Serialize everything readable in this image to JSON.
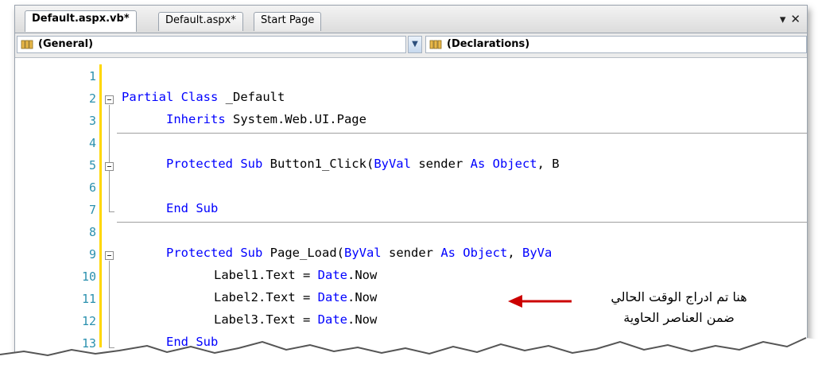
{
  "tabs": [
    {
      "label": "Default.aspx.vb*",
      "active": true
    },
    {
      "label": "Default.aspx*",
      "active": false
    },
    {
      "label": "Start Page",
      "active": false
    }
  ],
  "tab_controls": {
    "dropdown_glyph": "▾",
    "close_glyph": "✕"
  },
  "dropdowns": {
    "object_selector": "(General)",
    "member_selector": "(Declarations)"
  },
  "line_numbers": [
    "1",
    "2",
    "3",
    "4",
    "5",
    "6",
    "7",
    "8",
    "9",
    "10",
    "11",
    "12",
    "13"
  ],
  "code": {
    "line2": [
      {
        "t": "Partial Class",
        "kw": true
      },
      {
        "t": " _Default",
        "kw": false
      }
    ],
    "line3": [
      {
        "t": "Inherits",
        "kw": true
      },
      {
        "t": " System.Web.UI.Page",
        "kw": false
      }
    ],
    "line5": [
      {
        "t": "Protected Sub",
        "kw": true
      },
      {
        "t": " Button1_Click(",
        "kw": false
      },
      {
        "t": "ByVal",
        "kw": true
      },
      {
        "t": " sender ",
        "kw": false
      },
      {
        "t": "As Object",
        "kw": true
      },
      {
        "t": ", B",
        "kw": false
      }
    ],
    "line7": [
      {
        "t": "End Sub",
        "kw": true
      }
    ],
    "line9": [
      {
        "t": "Protected Sub",
        "kw": true
      },
      {
        "t": " Page_Load(",
        "kw": false
      },
      {
        "t": "ByVal",
        "kw": true
      },
      {
        "t": " sender ",
        "kw": false
      },
      {
        "t": "As Object",
        "kw": true
      },
      {
        "t": ", ",
        "kw": false
      },
      {
        "t": "ByVa",
        "kw": true
      }
    ],
    "line10": [
      {
        "t": "Label1.Text = ",
        "kw": false
      },
      {
        "t": "Date",
        "kw": true
      },
      {
        "t": ".Now",
        "kw": false
      }
    ],
    "line11": [
      {
        "t": "Label2.Text = ",
        "kw": false
      },
      {
        "t": "Date",
        "kw": true
      },
      {
        "t": ".Now",
        "kw": false
      }
    ],
    "line12": [
      {
        "t": "Label3.Text = ",
        "kw": false
      },
      {
        "t": "Date",
        "kw": true
      },
      {
        "t": ".Now",
        "kw": false
      }
    ],
    "line13": [
      {
        "t": "End Sub",
        "kw": true
      }
    ]
  },
  "annotation": {
    "line1": "هنا تم ادراج الوقت الحالي",
    "line2": "ضمن العناصر الحاوية"
  },
  "colors": {
    "keyword": "#0000ff",
    "line_number": "#2b91af",
    "arrow": "#cc0000",
    "change_margin": "#ffd700"
  }
}
